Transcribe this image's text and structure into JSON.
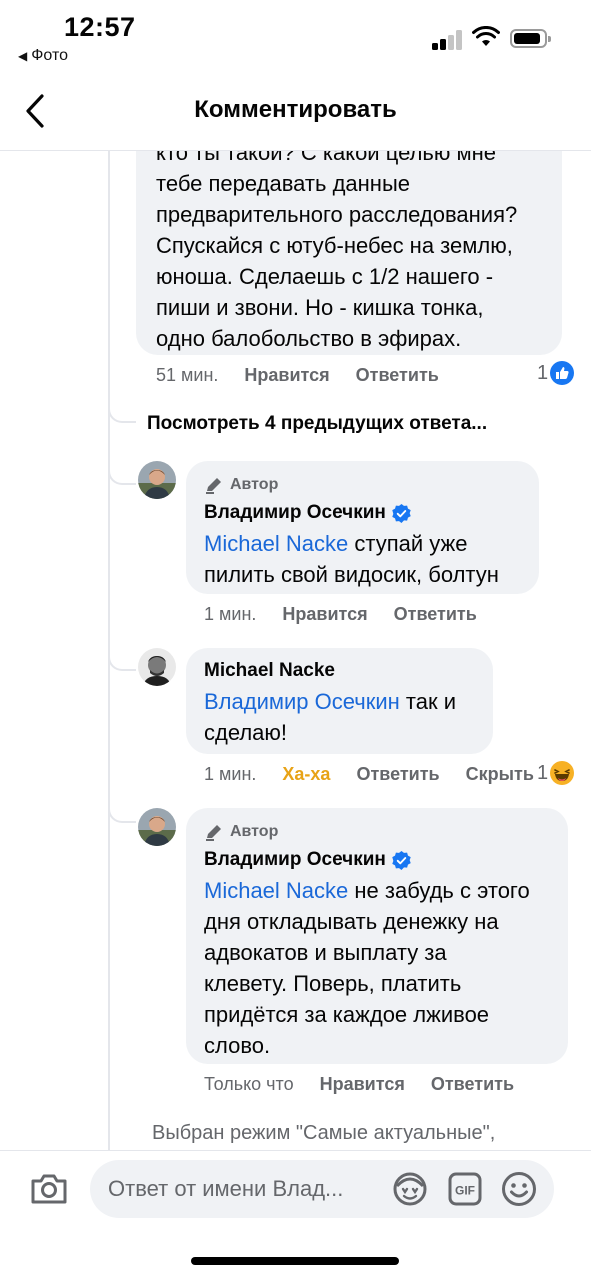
{
  "status_bar": {
    "time": "12:57",
    "back_app": "Фото"
  },
  "header": {
    "title": "Комментировать"
  },
  "top_comment": {
    "lines": [
      "кто ты такой? С какой целью мне",
      "тебе передавать данные",
      "предварительного расследования?",
      "Спускайся с ютуб-небес на землю,",
      "юноша. Сделаешь с 1/2 нашего -",
      "пиши и звони. Но - кишка тонка,",
      "одно балобольство в эфирах."
    ],
    "time": "51 мин.",
    "like": "Нравится",
    "reply": "Ответить",
    "reaction_count": "1",
    "reaction_icon": "like-icon"
  },
  "view_previous": "Посмотреть 4 предыдущих ответа...",
  "reply1": {
    "author_badge": "Автор",
    "name": "Владимир Осечкин",
    "mention": "Michael Nacke",
    "text_first": " ступай уже",
    "text_rest": "пилить свой видосик, болтун",
    "time": "1 мин.",
    "like": "Нравится",
    "reply": "Ответить"
  },
  "reply2": {
    "name": "Michael Nacke",
    "mention": "Владимир Осечкин",
    "text_first": " так и",
    "text_rest": "сделаю!",
    "time": "1 мин.",
    "reaction_label": "Ха-ха",
    "reply": "Ответить",
    "hide": "Скрыть",
    "reaction_count": "1",
    "reaction_icon": "haha-icon"
  },
  "reply3": {
    "author_badge": "Автор",
    "name": "Владимир Осечкин",
    "mention": "Michael Nacke",
    "text_first": " не забудь с этого",
    "lines": [
      "дня откладывать денежку на",
      "адвокатов и выплату за",
      "клевету. Поверь, платить",
      "придётся за каждое лживое",
      "слово."
    ],
    "time": "Только что",
    "like": "Нравится",
    "reply": "Ответить"
  },
  "mode_note": "Выбран режим \"Самые актуальные\",",
  "composer": {
    "placeholder": "Ответ от имени Влад..."
  },
  "colors": {
    "mention": "#1a68d8",
    "bubble": "#f0f2f5",
    "meta": "#65676b",
    "verified": "#1877f2",
    "haha": "#e8a317"
  }
}
